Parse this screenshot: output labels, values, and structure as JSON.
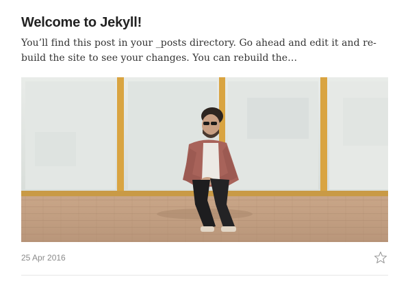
{
  "post": {
    "title": "Welcome to Jekyll!",
    "excerpt": "You’ll find this post in your _posts directory. Go ahead and edit it and re-build the site to see your changes. You can rebuild the…",
    "date": "25 Apr 2016",
    "image_alt": ""
  },
  "icons": {
    "bookmark": "star-outline-icon"
  },
  "colors": {
    "title": "#222222",
    "body_text": "#333333",
    "meta_text": "#8a8a8a",
    "divider": "#e6e6e6",
    "star_outline": "#9a9a9a"
  }
}
